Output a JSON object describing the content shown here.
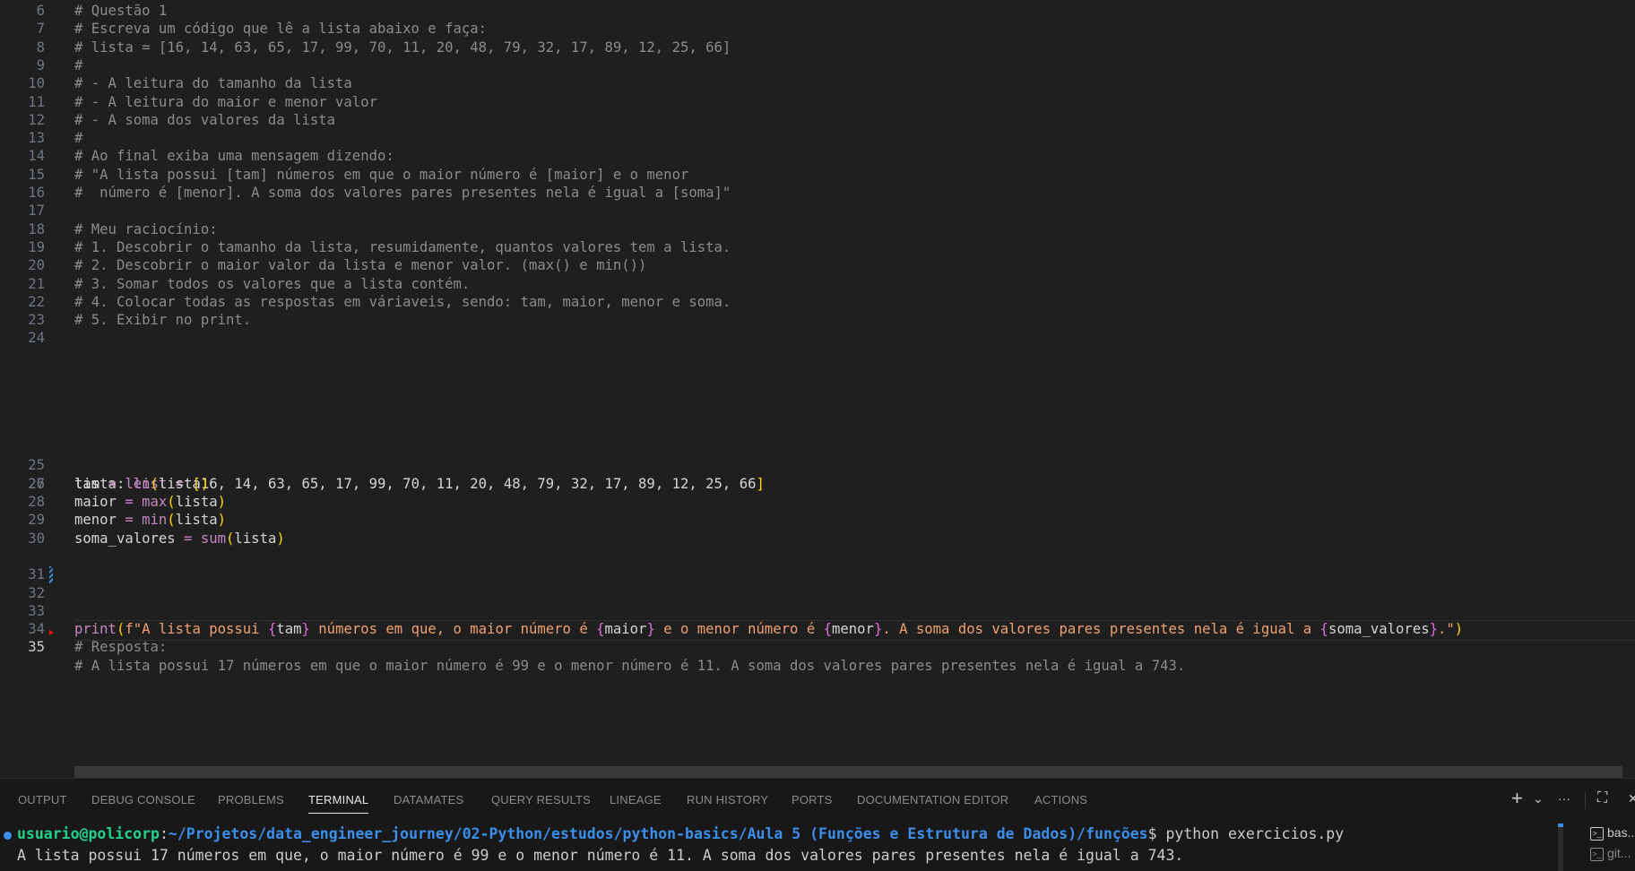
{
  "editor": {
    "lines": [
      {
        "n": "6",
        "t": "# Questão 1"
      },
      {
        "n": "7",
        "t": "# Escreva um código que lê a lista abaixo e faça:"
      },
      {
        "n": "8",
        "t": "# lista = [16, 14, 63, 65, 17, 99, 70, 11, 20, 48, 79, 32, 17, 89, 12, 25, 66]"
      },
      {
        "n": "9",
        "t": "#"
      },
      {
        "n": "10",
        "t": "# - A leitura do tamanho da lista"
      },
      {
        "n": "11",
        "t": "# - A leitura do maior e menor valor"
      },
      {
        "n": "12",
        "t": "# - A soma dos valores da lista"
      },
      {
        "n": "13",
        "t": "#"
      },
      {
        "n": "14",
        "t": "# Ao final exiba uma mensagem dizendo:"
      },
      {
        "n": "15",
        "t": "# \"A lista possui [tam] números em que o maior número é [maior] e o menor"
      },
      {
        "n": "16",
        "t": "#  número é [menor]. A soma dos valores pares presentes nela é igual a [soma]\""
      },
      {
        "n": "17",
        "t": ""
      },
      {
        "n": "18",
        "t": "# Meu raciocínio:"
      },
      {
        "n": "19",
        "t": "# 1. Descobrir o tamanho da lista, resumidamente, quantos valores tem a lista."
      },
      {
        "n": "20",
        "t": "# 2. Descobrir o maior valor da lista e menor valor. (max() e min())"
      },
      {
        "n": "21",
        "t": "# 3. Somar todos os valores que a lista contém."
      },
      {
        "n": "22",
        "t": "# 4. Colocar todas as respostas em váriaveis, sendo: tam, maior, menor e soma."
      },
      {
        "n": "23",
        "t": "# 5. Exibir no print."
      },
      {
        "n": "24",
        "t": ""
      }
    ],
    "line25": {
      "n": "25",
      "var": "lista",
      "colon": ": ",
      "type": "list",
      "eq": " = ",
      "open": "[",
      "values": "16, 14, 63, 65, 17, 99, 70, 11, 20, 48, 79, 32, 17, 89, 12, 25, 66",
      "close": "]"
    },
    "line26": {
      "n": "26"
    },
    "assigns": [
      {
        "n": "27",
        "var": "tam",
        "fn": "len",
        "arg": "lista"
      },
      {
        "n": "28",
        "var": "maior",
        "fn": "max",
        "arg": "lista"
      },
      {
        "n": "29",
        "var": "menor",
        "fn": "min",
        "arg": "lista"
      },
      {
        "n": "30",
        "var": "soma_valores",
        "fn": "sum",
        "arg": "lista"
      }
    ],
    "line31": {
      "n": "31"
    },
    "line32": {
      "n": "32",
      "fn": "print",
      "s1": "f\"A lista possui ",
      "v1": "tam",
      "s2": " números em que, o maior número é ",
      "v2": "maior",
      "s3": " e o menor número é ",
      "v3": "menor",
      "s4": ". A soma dos valores pares presentes nela é igual a ",
      "v4": "soma_valores",
      "s5": ".\""
    },
    "line33": {
      "n": "33"
    },
    "line34": {
      "n": "34",
      "t": "# Resposta:"
    },
    "line35": {
      "n": "35",
      "t": "# A lista possui 17 números em que o maior número é 99 e o menor número é 11. A soma dos valores pares presentes nela é igual a 743."
    }
  },
  "panel": {
    "tabs": [
      "OUTPUT",
      "DEBUG CONSOLE",
      "PROBLEMS",
      "TERMINAL",
      "DATAMATES",
      "QUERY RESULTS",
      "LINEAGE",
      "RUN HISTORY",
      "PORTS",
      "DOCUMENTATION EDITOR",
      "ACTIONS"
    ],
    "active_tab": "TERMINAL",
    "actions": {
      "add": "+",
      "dropdown": "⌄",
      "more": "···",
      "maximize": "⛶",
      "close": "✕"
    }
  },
  "terminal": {
    "user": "usuario@policorp",
    "sep": ":",
    "path": "~/Projetos/data_engineer_journey/02-Python/estudos/python-basics/Aula 5 (Funções e Estrutura de Dados)/funções",
    "prompt_end": "$ ",
    "command": "python exercicios.py",
    "output": "A lista possui 17 números em que, o maior número é 99 e o menor número é 11. A soma dos valores pares presentes nela é igual a 743.",
    "sessions": [
      "bas...",
      "git..."
    ]
  },
  "colors": {
    "background": "#1f1f1f",
    "comment": "#8b8b8b",
    "keyword": "#c586c0",
    "string": "#ce9178",
    "bracket": "#ffd700",
    "prompt_user": "#23d18b",
    "prompt_path": "#3b8eea"
  }
}
